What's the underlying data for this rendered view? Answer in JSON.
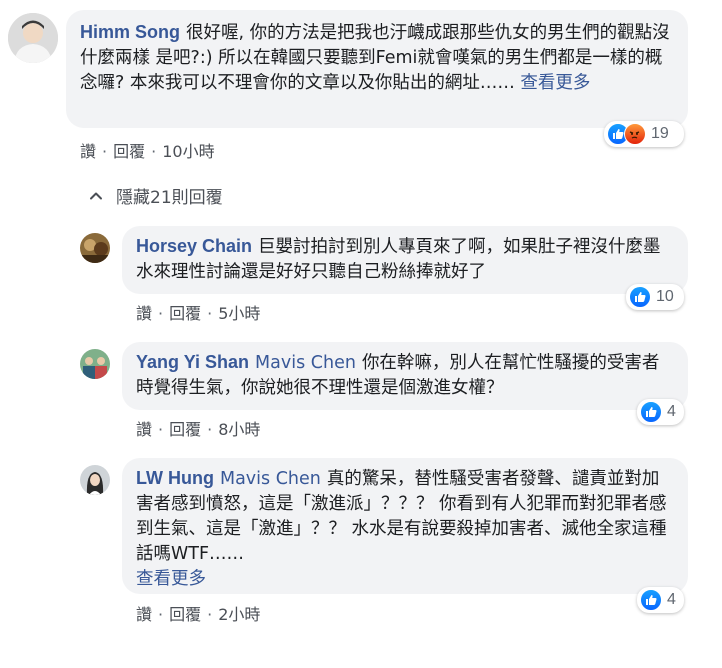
{
  "comments": [
    {
      "author": "Himm Song",
      "mention": "",
      "text": "很好喔, 你的方法是把我也汙衊成跟那些仇女的男生們的觀點沒什麼兩樣 是吧?:) 所以在韓國只要聽到Femi就會嘆氣的男生們都是一樣的概念囉? 本來我可以不理會你的文章以及你貼出的網址…… ",
      "see_more": "查看更多",
      "like_label": "讚",
      "reply_label": "回覆",
      "time": "10小時",
      "reaction_count": "19",
      "reactions": [
        "like-icon",
        "angry-icon"
      ]
    },
    {
      "author": "Horsey Chain",
      "mention": "",
      "text": "巨嬰討拍討到別人專頁來了啊，如果肚子裡沒什麼墨水來理性討論還是好好只聽自己粉絲捧就好了",
      "see_more": "",
      "like_label": "讚",
      "reply_label": "回覆",
      "time": "5小時",
      "reaction_count": "10",
      "reactions": [
        "like-icon"
      ]
    },
    {
      "author": "Yang Yi Shan",
      "mention": "Mavis Chen",
      "text": "你在幹嘛，別人在幫忙性騷擾的受害者時覺得生氣，你說她很不理性還是個激進女權？",
      "see_more": "",
      "like_label": "讚",
      "reply_label": "回覆",
      "time": "8小時",
      "reaction_count": "4",
      "reactions": [
        "like-icon"
      ]
    },
    {
      "author": "LW Hung",
      "mention": "Mavis Chen",
      "text": "真的驚呆，替性騷受害者發聲、譴責並對加害者感到憤怒，這是「激進派」？？？ 你看到有人犯罪而對犯罪者感到生氣、這是「激進」？？ 水水是有說要殺掉加害者、滅他全家這種話嗎WTF……",
      "see_more": "查看更多",
      "like_label": "讚",
      "reply_label": "回覆",
      "time": "2小時",
      "reaction_count": "4",
      "reactions": [
        "like-icon"
      ]
    }
  ],
  "hide_replies": {
    "label": "隱藏21則回覆",
    "icon": "chevron-up-icon"
  },
  "colors": {
    "link": "#385898",
    "bubble": "#f2f3f5",
    "like": "#1877f2",
    "angry": "#e9710f",
    "meta": "#4b4f56"
  }
}
